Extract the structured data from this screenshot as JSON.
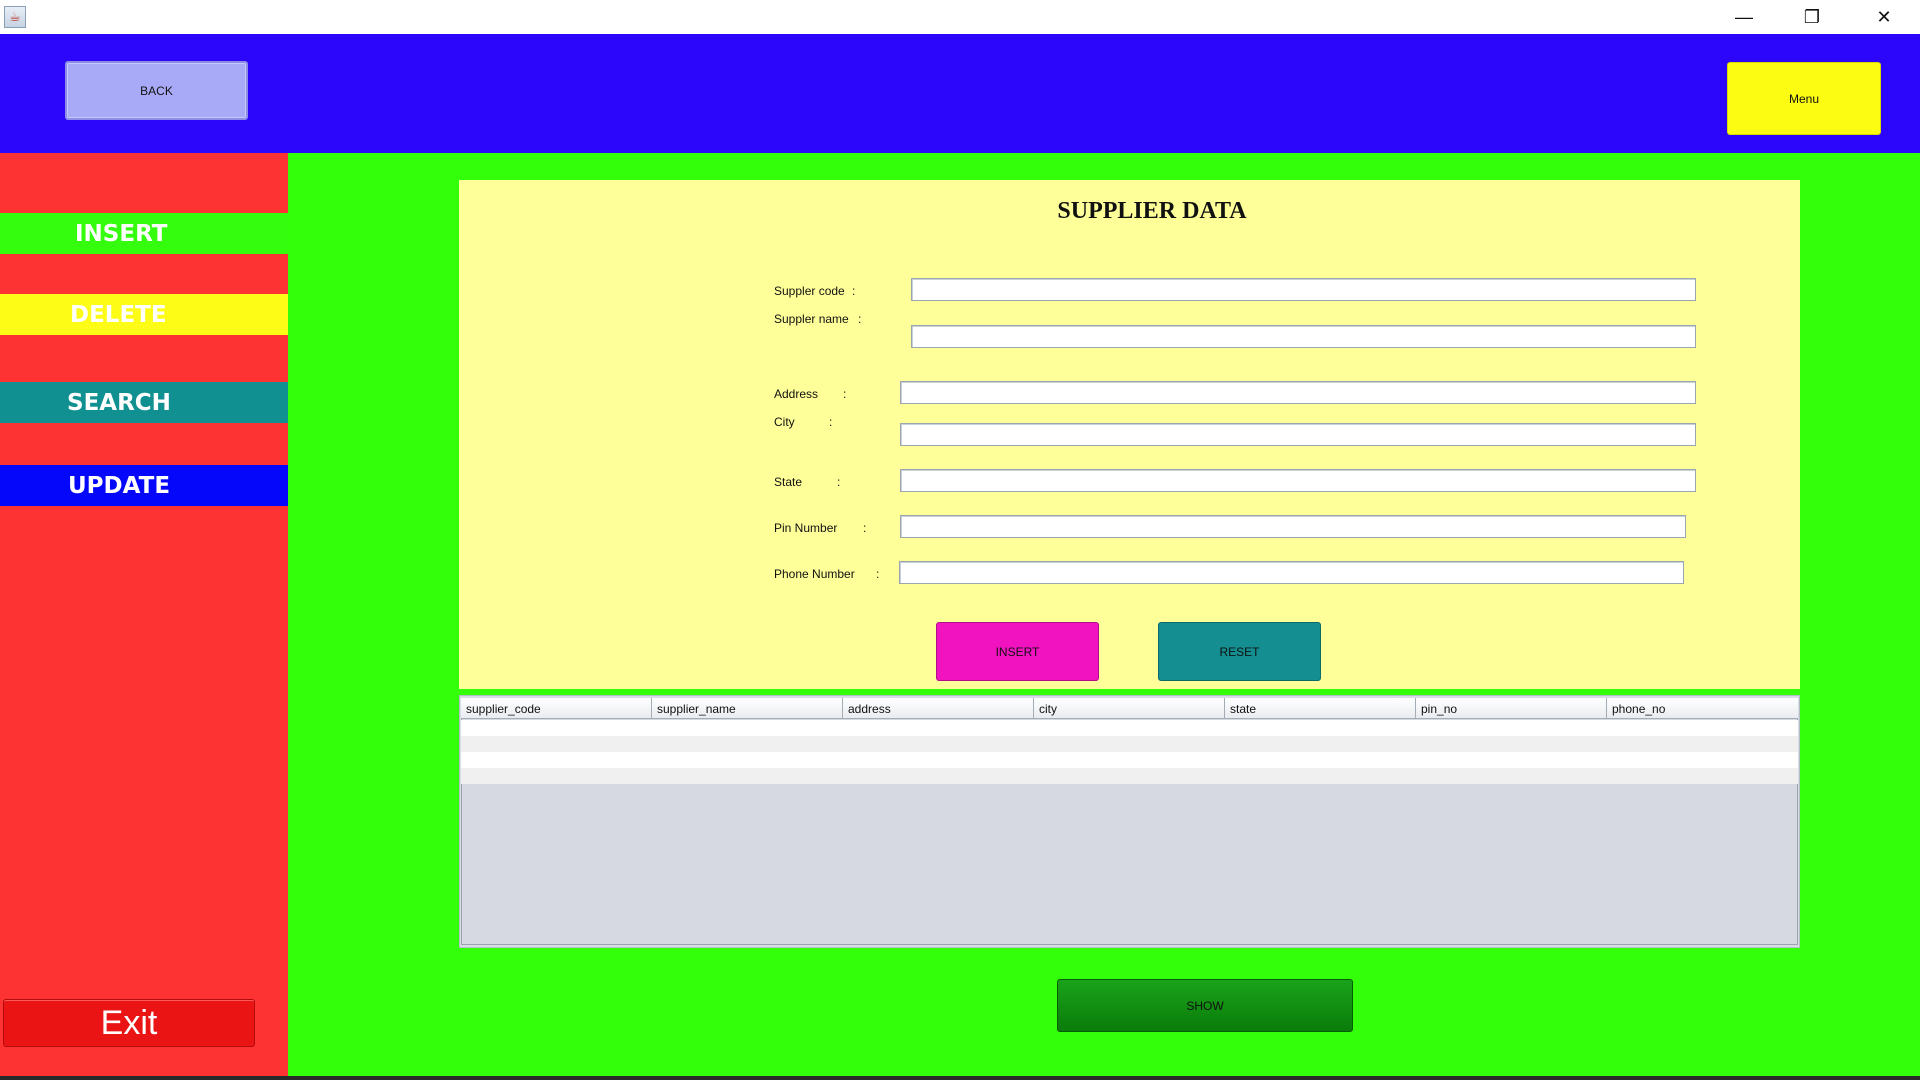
{
  "titlebar": {
    "icons": {
      "app": "java-cup-icon",
      "minimize": "minimize-icon",
      "maximize": "restore-icon",
      "close": "close-icon"
    },
    "minimize_glyph": "—",
    "maximize_glyph": "❐",
    "close_glyph": "✕"
  },
  "header": {
    "back_label": "BACK",
    "menu_label": "Menu"
  },
  "sidebar": {
    "items": [
      {
        "label": "INSERT",
        "color": "#34fd0e"
      },
      {
        "label": "DELETE",
        "color": "#fcfc17"
      },
      {
        "label": "SEARCH",
        "color": "#109090"
      },
      {
        "label": "UPDATE",
        "color": "#0507fb"
      }
    ],
    "exit_label": "Exit"
  },
  "form": {
    "title": "SUPPLIER DATA",
    "fields": [
      {
        "label": "Suppler code",
        "value": ""
      },
      {
        "label": "Suppler name",
        "value": ""
      },
      {
        "label": "Address",
        "value": ""
      },
      {
        "label": "City",
        "value": ""
      },
      {
        "label": "State",
        "value": ""
      },
      {
        "label": "Pin Number",
        "value": ""
      },
      {
        "label": "Phone Number",
        "value": ""
      }
    ],
    "insert_label": "INSERT",
    "reset_label": "RESET"
  },
  "table": {
    "columns": [
      "supplier_code",
      "supplier_name",
      "address",
      "city",
      "state",
      "pin_no",
      "phone_no"
    ],
    "rows": []
  },
  "show_label": "SHOW",
  "colors": {
    "header": "#2b06fb",
    "sidebar": "#fd3233",
    "main": "#34ff0b",
    "form_panel": "#ffff99",
    "menu": "#fcfc12",
    "insert_button": "#f113c0",
    "reset_button": "#158e91",
    "show_button": "#0f8f0f",
    "exit_button": "#ea1414"
  }
}
